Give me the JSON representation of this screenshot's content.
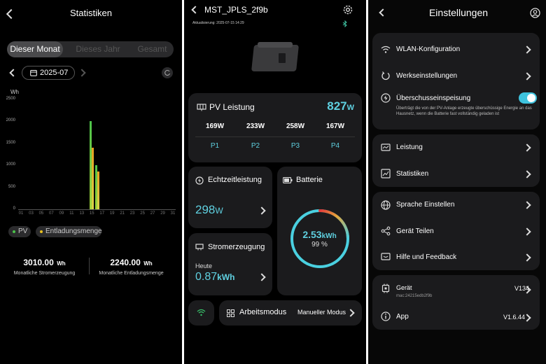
{
  "stats": {
    "title": "Statistiken",
    "tabs": [
      {
        "label": "Dieser Monat",
        "active": true
      },
      {
        "label": "Dieses Jahr",
        "active": false
      },
      {
        "label": "Gesamt",
        "active": false
      }
    ],
    "date": "2025-07",
    "unit": "Wh",
    "legend": [
      {
        "label": "PV",
        "color": "#4cc34a"
      },
      {
        "label": "Entladungsmenge",
        "color": "#e8c020"
      }
    ],
    "totals": [
      {
        "value": "3010.00",
        "unit": "Wh",
        "label": "Monatliche Stromerzeugung"
      },
      {
        "value": "2240.00",
        "unit": "Wh",
        "label": "Monatliche Entladungsmenge"
      }
    ]
  },
  "chart_data": {
    "type": "bar",
    "categories": [
      "01",
      "02",
      "03",
      "04",
      "05",
      "06",
      "07",
      "08",
      "09",
      "10",
      "11",
      "12",
      "13",
      "14",
      "15",
      "16",
      "17",
      "18",
      "19",
      "20",
      "21",
      "22",
      "23",
      "24",
      "25",
      "26",
      "27",
      "28",
      "29",
      "30",
      "31"
    ],
    "x_tick_labels": [
      "01",
      "03",
      "05",
      "07",
      "09",
      "11",
      "13",
      "15",
      "17",
      "19",
      "21",
      "23",
      "25",
      "27",
      "29",
      "31"
    ],
    "y_ticks": [
      0,
      500,
      1000,
      1500,
      2000,
      2500
    ],
    "ylabel": "Wh",
    "ylim": [
      0,
      2500
    ],
    "series": [
      {
        "name": "PV",
        "color": "#4cc34a",
        "values": [
          0,
          0,
          0,
          0,
          0,
          0,
          0,
          0,
          0,
          0,
          0,
          0,
          0,
          0,
          2010,
          1000,
          0,
          0,
          0,
          0,
          0,
          0,
          0,
          0,
          0,
          0,
          0,
          0,
          0,
          0,
          0
        ]
      },
      {
        "name": "Entladungsmenge",
        "color": "#e8c020",
        "values": [
          0,
          0,
          0,
          0,
          0,
          0,
          0,
          0,
          0,
          0,
          0,
          0,
          0,
          0,
          1400,
          860,
          0,
          0,
          0,
          0,
          0,
          0,
          0,
          0,
          0,
          0,
          0,
          0,
          0,
          0,
          0
        ]
      }
    ],
    "grid": false
  },
  "device": {
    "name": "MST_JPLS_2f9b",
    "updated": "Aktualisierung: 2025-07-15 14:29",
    "pv": {
      "title": "PV Leistung",
      "total": "827",
      "total_unit": "W",
      "channels": [
        {
          "value": "169W",
          "label": "P1"
        },
        {
          "value": "233W",
          "label": "P2"
        },
        {
          "value": "258W",
          "label": "P3"
        },
        {
          "value": "167W",
          "label": "P4"
        }
      ]
    },
    "realtime": {
      "title": "Echtzeitleistung",
      "value": "298",
      "unit": "W"
    },
    "generation": {
      "title": "Stromerzeugung",
      "period": "Heute",
      "value": "0.87",
      "unit": "kWh"
    },
    "battery": {
      "title": "Batterie",
      "energy": "2.53",
      "energy_unit": "kWh",
      "percent": "99 %",
      "fraction": 0.99
    },
    "mode": {
      "title": "Arbeitsmodus",
      "value": "Manueller Modus"
    }
  },
  "settings": {
    "title": "Einstellungen",
    "items": {
      "wifi": "WLAN-Konfiguration",
      "factory": "Werkseinstellungen",
      "surplus": "Überschusseinspeisung",
      "surplus_desc": "Überträgt die von der PV-Anlage erzeugte überschüssige Energie an das Hausnetz, wenn die Batterie fast vollständig geladen ist",
      "power": "Leistung",
      "stats": "Statistiken",
      "language": "Sprache Einstellen",
      "share": "Gerät Teilen",
      "help": "Hilfe und Feedback",
      "device": "Gerät",
      "device_mac": "mac:24215edb2f9b",
      "device_version": "V134",
      "app": "App",
      "app_version": "V1.6.44"
    },
    "surplus_enabled": true
  },
  "colors": {
    "accent": "#5fd0e0",
    "pv": "#4cc34a",
    "discharge": "#e8c020"
  }
}
